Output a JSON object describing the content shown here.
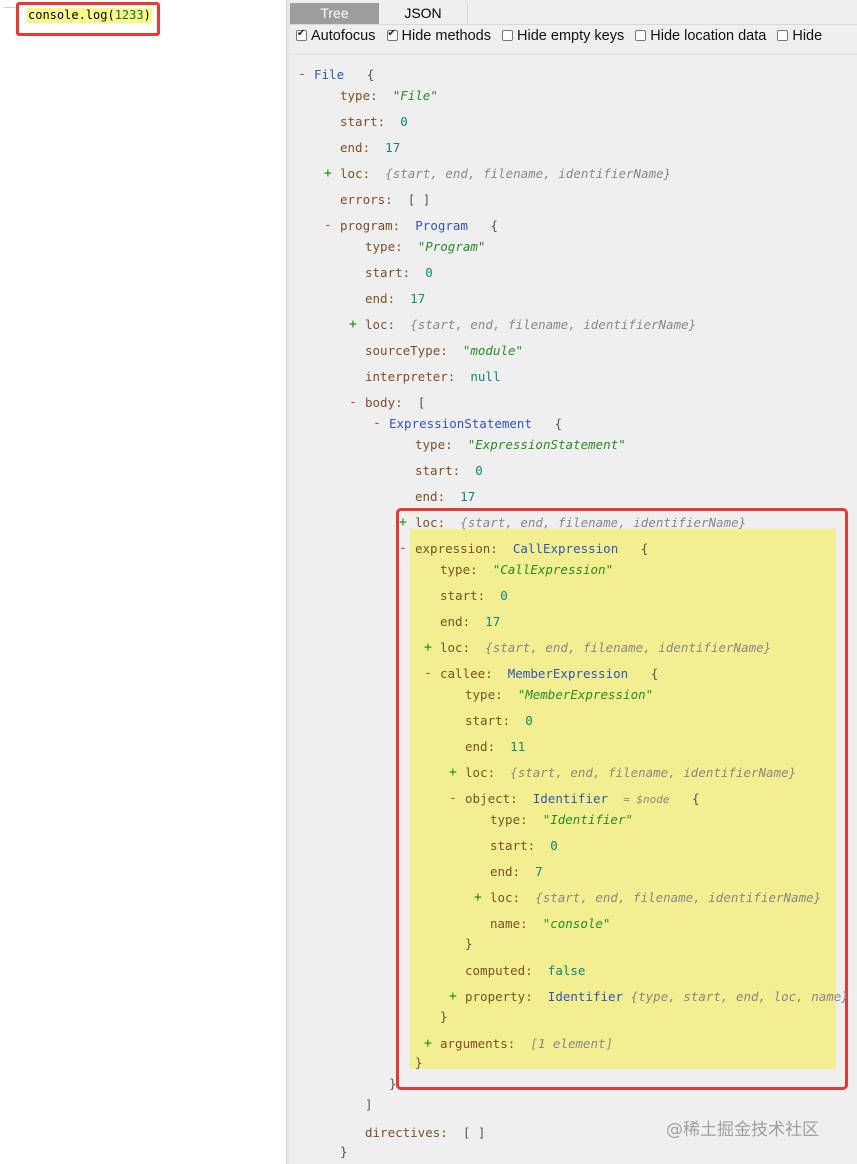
{
  "editor": {
    "code_prefix": "console.log(",
    "code_number": "1233",
    "code_suffix": ")"
  },
  "tabs": [
    {
      "label": "Tree",
      "active": true
    },
    {
      "label": "JSON",
      "active": false
    }
  ],
  "options": [
    {
      "label": "Autofocus",
      "checked": true
    },
    {
      "label": "Hide methods",
      "checked": true
    },
    {
      "label": "Hide empty keys",
      "checked": false
    },
    {
      "label": "Hide location data",
      "checked": false
    },
    {
      "label": "Hide",
      "checked": false
    }
  ],
  "colors": {
    "highlight_border": "#e23b35",
    "selection": "#f3ee90"
  },
  "tree": [
    {
      "toggle": "-",
      "key": "File",
      "value": "",
      "vclass": "",
      "suffix": "{",
      "suffix_class": "b",
      "dkey": "t"
    },
    {
      "key": "type:",
      "value": "\"File\"",
      "vclass": "s"
    },
    {
      "key": "start:",
      "value": "0",
      "vclass": "n"
    },
    {
      "key": "end:",
      "value": "17",
      "vclass": "n"
    },
    {
      "toggle": "+",
      "key": "loc:",
      "value": "{start, end, filename, identifierName}",
      "vclass": "c"
    },
    {
      "key": "errors:",
      "value": "[ ]",
      "vclass": "b"
    },
    {
      "toggle": "-",
      "key": "program:",
      "value": "Program",
      "vclass": "t",
      "suffix": "{",
      "suffix_class": "b"
    },
    {
      "key": "type:",
      "value": "\"Program\"",
      "vclass": "s"
    },
    {
      "key": "start:",
      "value": "0",
      "vclass": "n"
    },
    {
      "key": "end:",
      "value": "17",
      "vclass": "n"
    },
    {
      "toggle": "+",
      "key": "loc:",
      "value": "{start, end, filename, identifierName}",
      "vclass": "c"
    },
    {
      "key": "sourceType:",
      "value": "\"module\"",
      "vclass": "s"
    },
    {
      "key": "interpreter:",
      "value": "null",
      "vclass": "n"
    },
    {
      "toggle": "-",
      "key": "body:",
      "value": "[",
      "vclass": "b"
    },
    {
      "toggle": "-",
      "key": "ExpressionStatement",
      "value": "",
      "vclass": "",
      "suffix": "{",
      "suffix_class": "b",
      "dkey": "t"
    },
    {
      "key": "type:",
      "value": "\"ExpressionStatement\"",
      "vclass": "s"
    },
    {
      "key": "start:",
      "value": "0",
      "vclass": "n"
    },
    {
      "key": "end:",
      "value": "17",
      "vclass": "n"
    },
    {
      "toggle": "+",
      "key": "loc:",
      "value": "{start, end, filename, identifierName}",
      "vclass": "c"
    },
    {
      "toggle": "-",
      "key": "expression:",
      "value": "CallExpression",
      "vclass": "t",
      "suffix": "{",
      "suffix_class": "b"
    },
    {
      "key": "type:",
      "value": "\"CallExpression\"",
      "vclass": "s"
    },
    {
      "key": "start:",
      "value": "0",
      "vclass": "n"
    },
    {
      "key": "end:",
      "value": "17",
      "vclass": "n"
    },
    {
      "toggle": "+",
      "key": "loc:",
      "value": "{start, end, filename, identifierName}",
      "vclass": "c"
    },
    {
      "toggle": "-",
      "key": "callee:",
      "value": "MemberExpression",
      "vclass": "t",
      "suffix": "{",
      "suffix_class": "b"
    },
    {
      "key": "type:",
      "value": "\"MemberExpression\"",
      "vclass": "s"
    },
    {
      "key": "start:",
      "value": "0",
      "vclass": "n"
    },
    {
      "key": "end:",
      "value": "11",
      "vclass": "n"
    },
    {
      "toggle": "+",
      "key": "loc:",
      "value": "{start, end, filename, identifierName}",
      "vclass": "c"
    },
    {
      "toggle": "-",
      "key": "object:",
      "value": "Identifier",
      "vclass": "t",
      "note": "= $node",
      "suffix": "{",
      "suffix_class": "b"
    },
    {
      "key": "type:",
      "value": "\"Identifier\"",
      "vclass": "s"
    },
    {
      "key": "start:",
      "value": "0",
      "vclass": "n"
    },
    {
      "key": "end:",
      "value": "7",
      "vclass": "n"
    },
    {
      "toggle": "+",
      "key": "loc:",
      "value": "{start, end, filename, identifierName}",
      "vclass": "c"
    },
    {
      "key": "name:",
      "value": "\"console\"",
      "vclass": "s"
    },
    {
      "key": "}",
      "value": "",
      "vclass": "",
      "dkey": "p"
    },
    {
      "key": "computed:",
      "value": "false",
      "vclass": "n"
    },
    {
      "toggle": "+",
      "key": "property:",
      "value": "Identifier",
      "vclass": "t",
      "suffix": "{type, start, end, loc, name}",
      "suffix_class": "c"
    },
    {
      "key": "}",
      "value": "",
      "vclass": "",
      "dkey": "p"
    },
    {
      "toggle": "+",
      "key": "arguments:",
      "value": "[1 element]",
      "vclass": "c"
    },
    {
      "key": "}",
      "value": "",
      "vclass": "",
      "dkey": "p"
    },
    {
      "key": "}",
      "value": "",
      "vclass": "",
      "dkey": "p"
    },
    {
      "key": "]",
      "value": "",
      "vclass": "",
      "dkey": "p"
    },
    {
      "key": "directives:",
      "value": "[ ]",
      "vclass": "b"
    },
    {
      "key": "}",
      "value": "",
      "vclass": "",
      "dkey": "p"
    }
  ],
  "watermark": "@稀土掘金技术社区"
}
